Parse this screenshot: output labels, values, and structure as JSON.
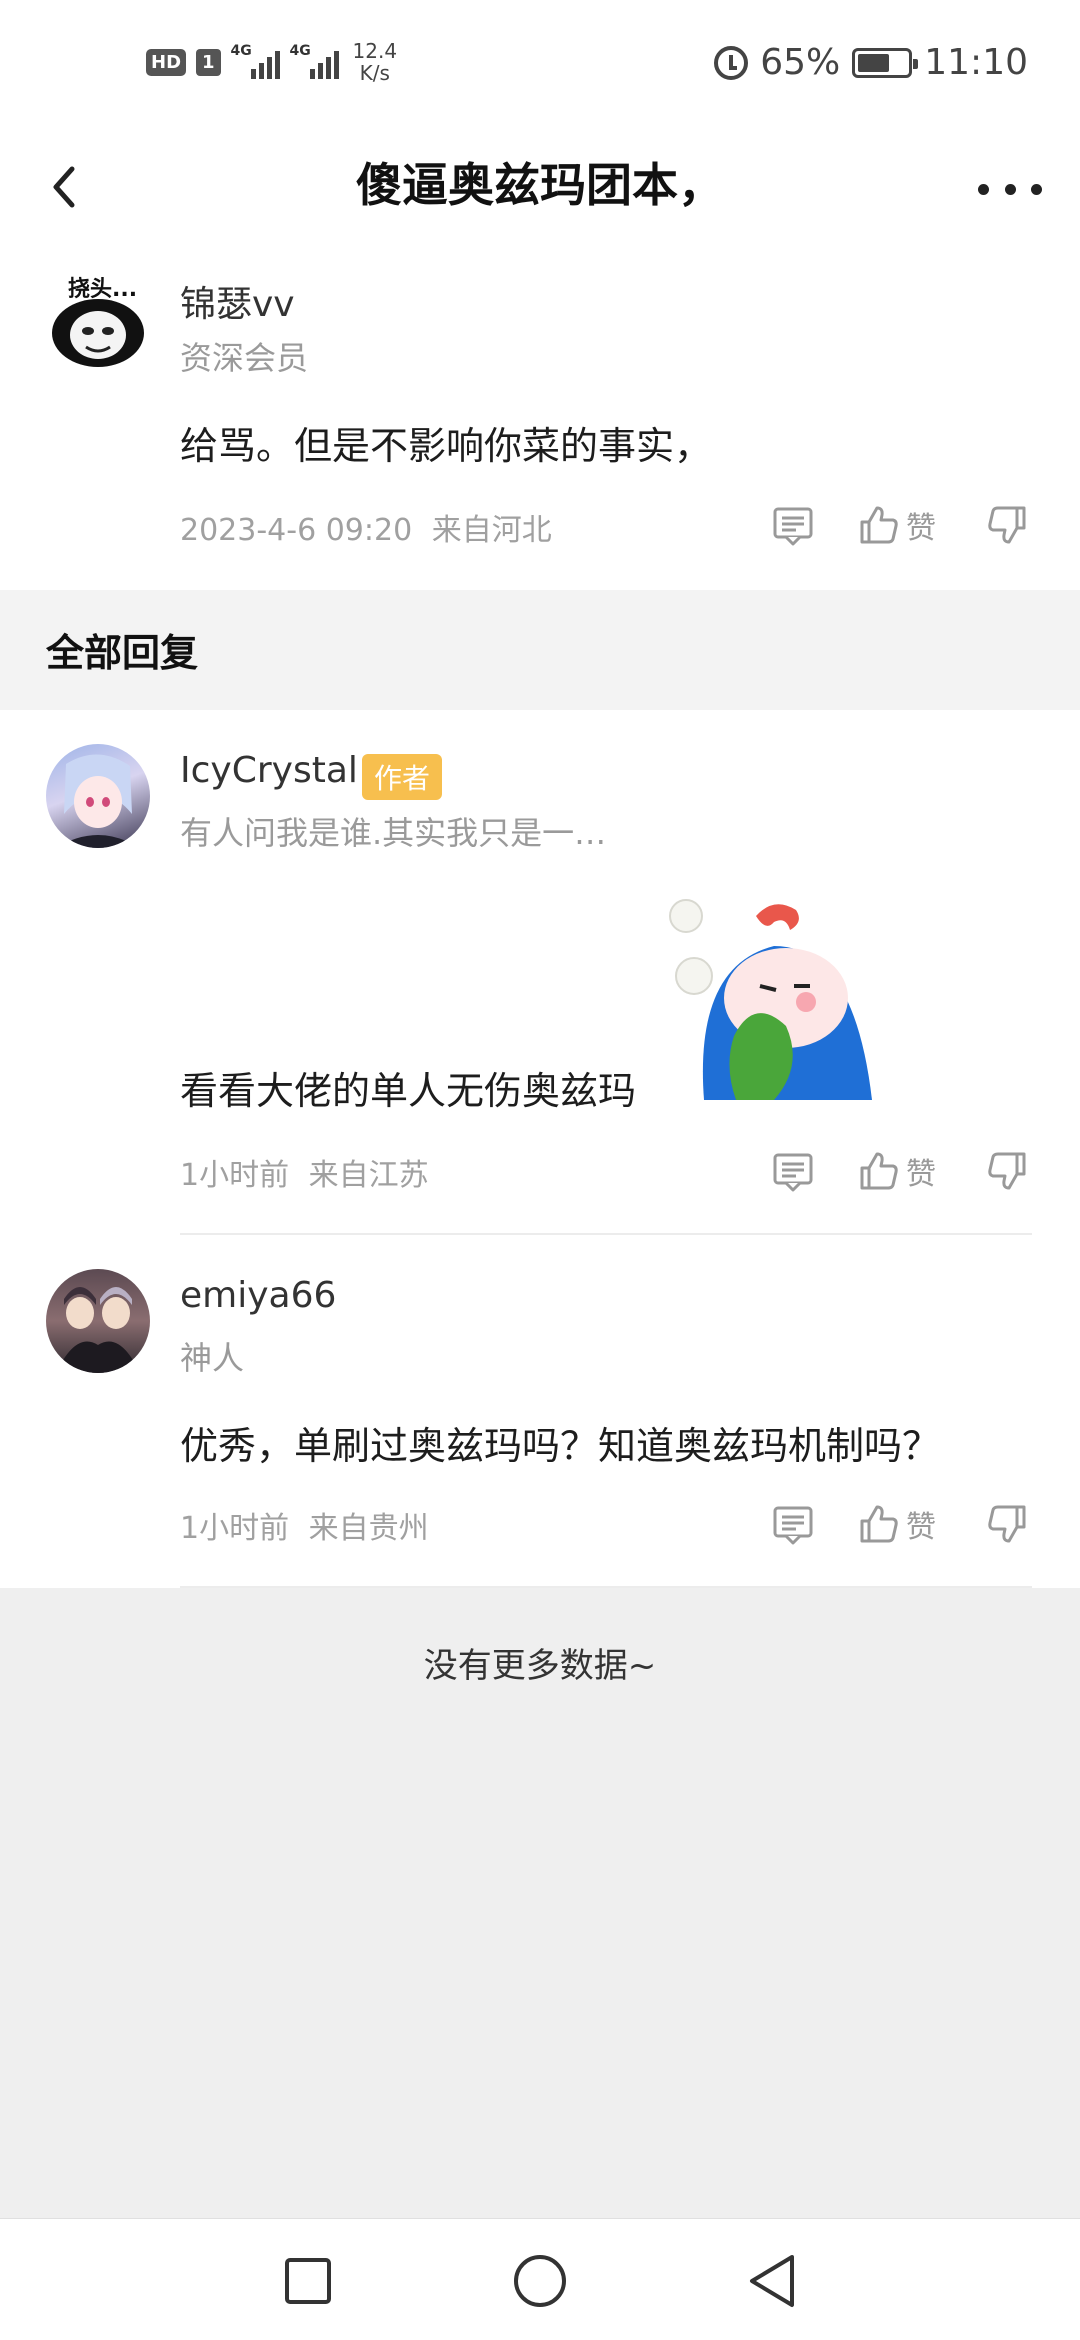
{
  "status_bar": {
    "hd_label": "HD",
    "sim_label": "1",
    "network_1": "4G",
    "network_2": "4G",
    "speed_value": "12.4",
    "speed_unit": "K/s",
    "battery": "65%",
    "battery_level": 0.65,
    "time": "11:10"
  },
  "header": {
    "title": "傻逼奥兹玛团本，"
  },
  "main_comment": {
    "avatar_text": "挠头...",
    "username": "锦瑟vv",
    "level": "资深会员",
    "content": "给骂。但是不影响你菜的事实，",
    "timestamp": "2023-4-6 09:20",
    "location": "来自河北",
    "like_label": "赞"
  },
  "section": {
    "title": "全部回复"
  },
  "replies": [
    {
      "username": "IcyCrystal",
      "badge": "作者",
      "signature": "有人问我是谁.其实我只是一…",
      "content": "看看大佬的单人无伤奥兹玛",
      "time": "1小时前",
      "location": "来自江苏",
      "like_label": "赞"
    },
    {
      "username": "emiya66",
      "level": "神人",
      "content": "优秀，单刷过奥兹玛吗？知道奥兹玛机制吗？",
      "time": "1小时前",
      "location": "来自贵州",
      "like_label": "赞"
    }
  ],
  "footer": {
    "no_more": "没有更多数据~"
  },
  "colors": {
    "badge": "#f7bf4e",
    "section_bg": "#f3f3f3",
    "footer_bg": "#efefef",
    "sticker_blue": "#1f6fd6"
  }
}
